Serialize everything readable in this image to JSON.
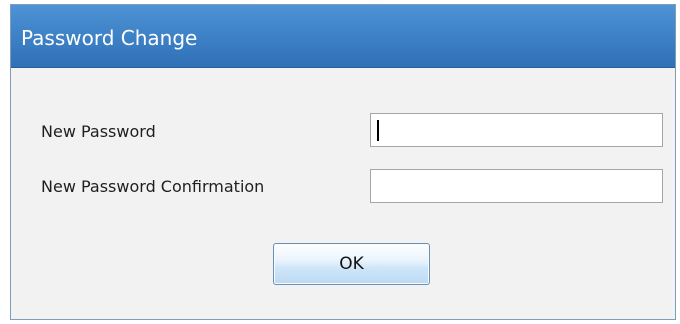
{
  "dialog": {
    "title": "Password Change"
  },
  "form": {
    "new_password_label": "New Password",
    "new_password_value": "",
    "confirm_password_label": "New Password Confirmation",
    "confirm_password_value": "",
    "ok_label": "OK"
  }
}
